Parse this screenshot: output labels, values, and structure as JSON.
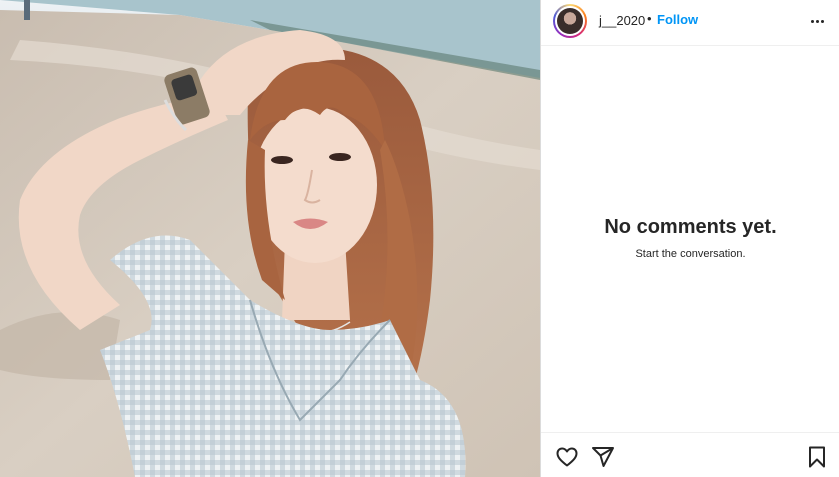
{
  "post": {
    "username": "j__2020",
    "separator": "•",
    "follow_label": "Follow"
  },
  "comments": {
    "empty_title": "No comments yet.",
    "empty_subtitle": "Start the conversation."
  },
  "icons": {
    "more": "more-options-icon",
    "like": "heart-icon",
    "share": "send-icon",
    "save": "bookmark-icon"
  },
  "colors": {
    "accent": "#0095f6",
    "text": "#262626",
    "border": "#dbdbdb"
  }
}
